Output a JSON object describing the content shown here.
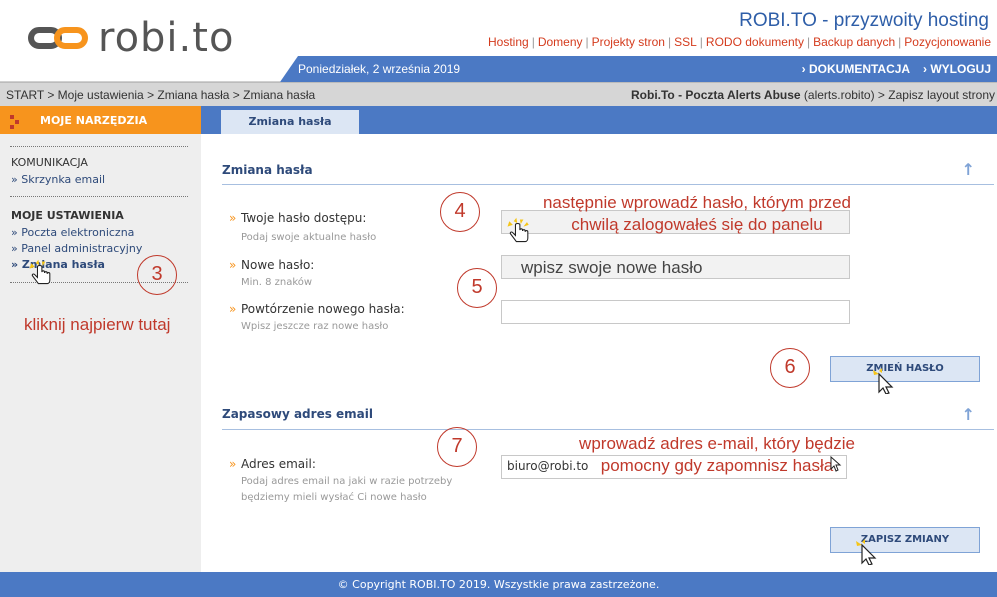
{
  "header": {
    "logo_text": "robi.to",
    "site_title": "ROBI.TO - przyzwoity hosting",
    "top_links": [
      "Hosting",
      "Domeny",
      "Projekty stron",
      "SSL",
      "RODO dokumenty",
      "Backup danych",
      "Pozycjonowanie"
    ],
    "date": "Poniedziałek, 2 września 2019",
    "docs_link": "› DOKUMENTACJA",
    "logout_link": "› WYLOGUJ"
  },
  "breadcrumb": {
    "path": "START > Moje ustawienia > Zmiana hasła > Zmiana hasła",
    "right_bold": "Robi.To - Poczta Alerts Abuse",
    "right_rest": " (alerts.robito) > Zapisz layout strony"
  },
  "sidebar": {
    "title": "MOJE NARZĘDZIA",
    "section1": "KOMUNIKACJA",
    "section1_items": [
      "» Skrzynka email"
    ],
    "section2": "MOJE USTAWIENIA",
    "section2_items": [
      "» Poczta elektroniczna",
      "» Panel administracyjny",
      "» Zmiana hasła"
    ]
  },
  "tab": {
    "label": "Zmiana hasła"
  },
  "password_section": {
    "title": "Zmiana hasła",
    "fields": [
      {
        "label": "Twoje hasło dostępu:",
        "hint": "Podaj swoje aktualne hasło",
        "value": ""
      },
      {
        "label": "Nowe hasło:",
        "hint": "Min. 8 znaków",
        "value": ""
      },
      {
        "label": "Powtórzenie nowego hasła:",
        "hint": "Wpisz jeszcze raz nowe hasło",
        "value": ""
      }
    ],
    "button": "ZMIEŃ HASŁO"
  },
  "email_section": {
    "title": "Zapasowy adres email",
    "label": "Adres email:",
    "hint": "Podaj adres email na jaki w razie potrzeby będziemy mieli wysłać Ci nowe hasło",
    "value": "biuro@robi.to",
    "button": "ZAPISZ ZMIANY"
  },
  "annotations": {
    "step3": "3",
    "step3_note": "kliknij najpierw tutaj",
    "step4": "4",
    "step4_note_line1": "następnie wprowadź hasło, którym przed",
    "step4_note_line2": "chwilą zalogowałeś się do panelu",
    "step5": "5",
    "step5_note": "wpisz swoje nowe hasło",
    "step6": "6",
    "step7": "7",
    "step7_note_line1": "wprowadź adres e-mail, który będzie",
    "step7_note_line2": "pomocny gdy zapomnisz hasła"
  },
  "footer": {
    "copyright": "© Copyright ROBI.TO 2019. Wszystkie prawa zastrzeżone."
  },
  "colors": {
    "accent_orange": "#f7941d",
    "brand_blue": "#4b79c4",
    "annotation_red": "#c0392b"
  }
}
